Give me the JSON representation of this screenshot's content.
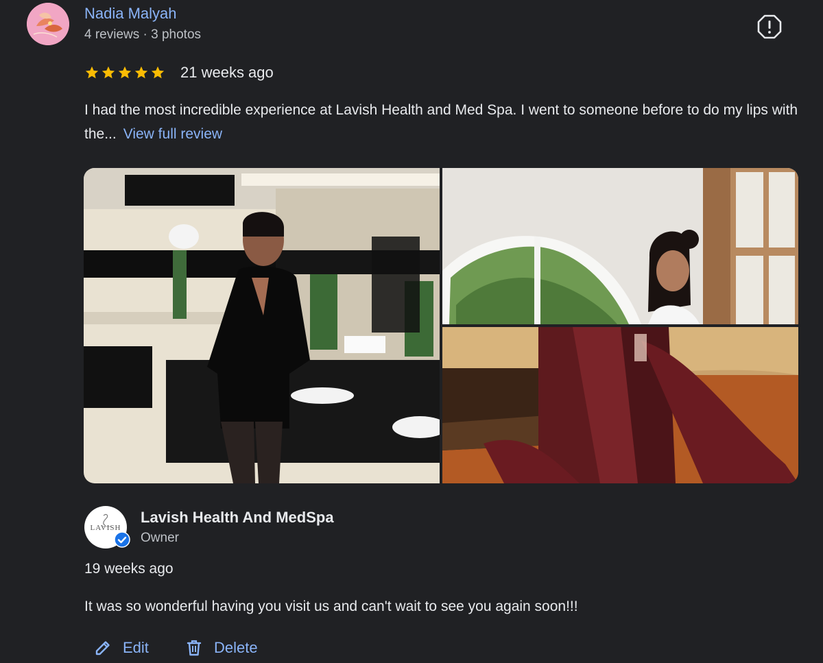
{
  "review": {
    "author_name": "Nadia Malyah",
    "author_meta": "4 reviews · 3 photos",
    "rating": 5,
    "rating_max": 5,
    "age": "21 weeks ago",
    "text": "I had the most incredible experience at Lavish Health and Med Spa. I went to someone before to do my lips with the...",
    "view_full_label": "View full review",
    "report_icon": "report-flag-icon",
    "photos": [
      {
        "name": "photo-restroom-mirror"
      },
      {
        "name": "photo-arched-window"
      },
      {
        "name": "photo-leather-booth"
      }
    ]
  },
  "reply": {
    "owner_name": "Lavish Health And MedSpa",
    "owner_role": "Owner",
    "logo_text": "LAVISH",
    "age": "19 weeks ago",
    "text": "It was so wonderful having you visit us and can't wait to see you again soon!!!"
  },
  "actions": {
    "edit_label": "Edit",
    "delete_label": "Delete"
  },
  "colors": {
    "background": "#202124",
    "link": "#8ab4f8",
    "star": "#fbbc04",
    "verified": "#1a73e8"
  }
}
